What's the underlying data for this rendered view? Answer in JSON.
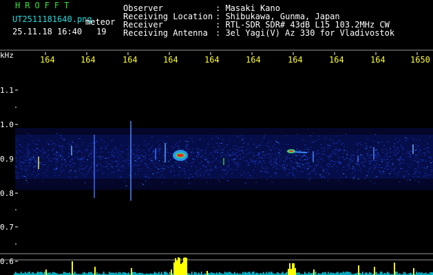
{
  "header": {
    "title": "HROFFT",
    "file_name": "UT2511181640.png",
    "meteor_label": "meteor",
    "datetime": "25.11.18 16:40",
    "count": "19",
    "info_labels": [
      "Observer",
      "Receiving Location",
      "Receiver",
      "Receiving Antenna"
    ],
    "info_values": [
      ": Masaki Kano",
      ": Shibukawa, Gunma, Japan",
      ": RTL-SDR SDR# 43dB L15 103.2MHz CW",
      ": 3el Yagi(V) Az 330 for Vladivostok"
    ]
  },
  "time_axis": {
    "ticks": [
      "164",
      "164",
      "164",
      "164",
      "164",
      "164",
      "164",
      "164",
      "164",
      "1650"
    ]
  },
  "freq_axis": {
    "unit": "kHz",
    "ticks": [
      "1.1",
      "1.0",
      "0.9",
      "0.8",
      "0.7",
      "0.6"
    ]
  },
  "colors": {
    "background": "#000000",
    "header_text": "#ffffff",
    "title": "#2ee82e",
    "file_text": "#1fdcdc",
    "time_ticks": "#ffff33",
    "grid": "#9a9a9a",
    "noise_band": "#1a2aa8",
    "signal_hot": "#ff2020",
    "activity": "#ffff00",
    "baseline": "#00e5ff"
  }
}
